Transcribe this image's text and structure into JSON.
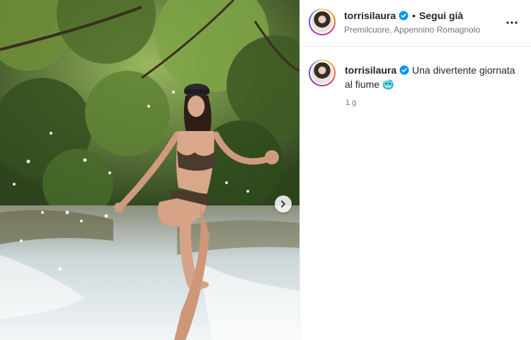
{
  "post": {
    "username": "torrisilaura",
    "follow_label": "Segui già",
    "separator": "•",
    "location": "Premilcuore, Appennino Romagnolo",
    "more_label": "more-options",
    "caption_text": "Una divertente giornata al fiume 🥶",
    "time": "1 g"
  },
  "icons": {
    "verified": "verified-badge-icon",
    "next": "chevron-right-icon",
    "more": "ellipsis-icon"
  },
  "colors": {
    "verified_blue": "#0095f6",
    "muted": "#737373",
    "text": "#262626"
  }
}
